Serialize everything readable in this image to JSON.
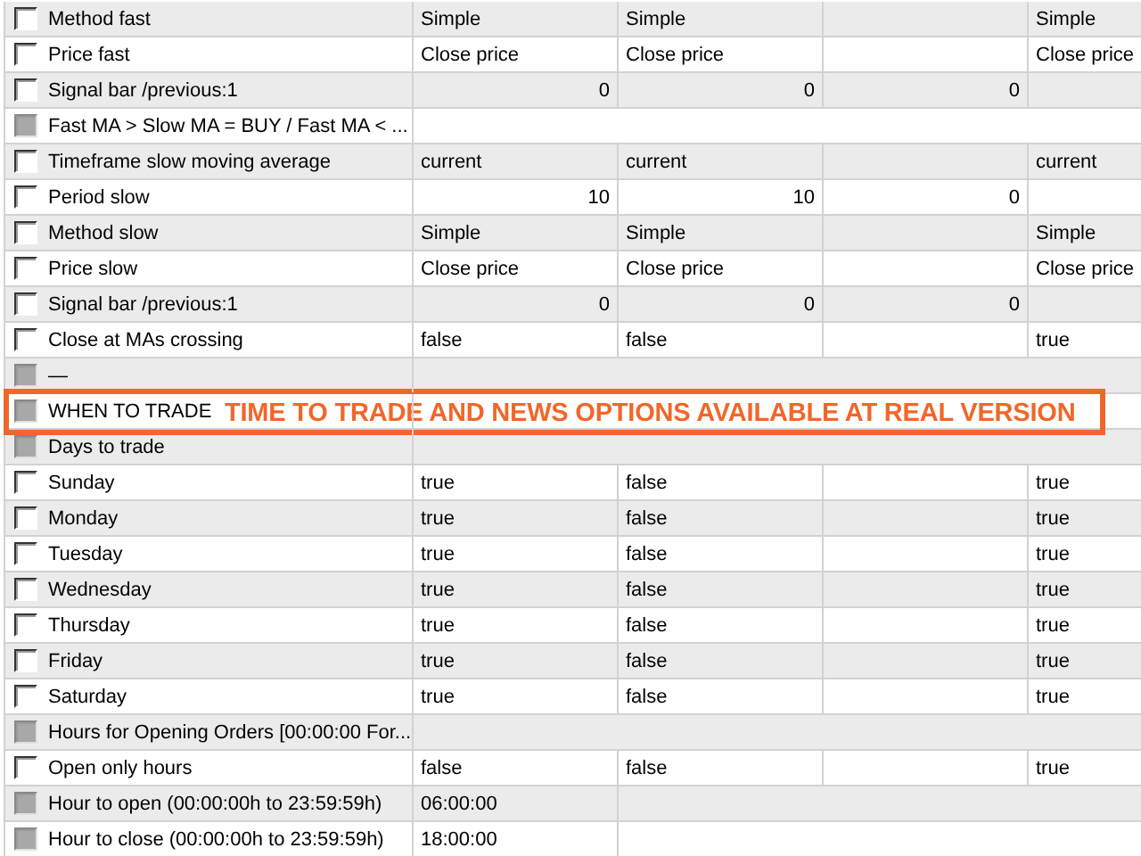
{
  "rows": [
    {
      "label": "Method fast",
      "kind": "text",
      "checked": false,
      "disabled": false,
      "column_2": "Simple",
      "column_3": "Simple",
      "column_5": "Simple"
    },
    {
      "label": "Price fast",
      "kind": "text",
      "checked": false,
      "disabled": false,
      "column_2": "Close price",
      "column_3": "Close price",
      "column_5": "Close price"
    },
    {
      "label": "Signal bar /previous:1",
      "kind": "number",
      "checked": false,
      "disabled": false,
      "column_2": "0",
      "column_3": "0",
      "column_4": "0"
    },
    {
      "label": "Fast MA > Slow MA = BUY / Fast MA < ...",
      "kind": "group",
      "checked": false,
      "disabled": true
    },
    {
      "label": "Timeframe slow moving average",
      "kind": "text",
      "checked": false,
      "disabled": false,
      "column_2": "current",
      "column_3": "current",
      "column_5": "current"
    },
    {
      "label": "Period slow",
      "kind": "number",
      "checked": false,
      "disabled": false,
      "column_2": "10",
      "column_3": "10",
      "column_4": "0"
    },
    {
      "label": "Method slow",
      "kind": "text",
      "checked": false,
      "disabled": false,
      "column_2": "Simple",
      "column_3": "Simple",
      "column_5": "Simple"
    },
    {
      "label": "Price slow",
      "kind": "text",
      "checked": false,
      "disabled": false,
      "column_2": "Close price",
      "column_3": "Close price",
      "column_5": "Close price"
    },
    {
      "label": "Signal bar /previous:1",
      "kind": "number",
      "checked": false,
      "disabled": false,
      "column_2": "0",
      "column_3": "0",
      "column_4": "0"
    },
    {
      "label": "Close at MAs crossing",
      "kind": "text",
      "checked": false,
      "disabled": false,
      "column_2": "false",
      "column_3": "false",
      "column_5": "true"
    },
    {
      "label": "—",
      "kind": "group",
      "checked": false,
      "disabled": true
    },
    {
      "label": "WHEN TO TRADE",
      "kind": "group",
      "checked": false,
      "disabled": true
    },
    {
      "label": "Days to trade",
      "kind": "group",
      "checked": false,
      "disabled": true
    },
    {
      "label": "Sunday",
      "kind": "text",
      "checked": false,
      "disabled": false,
      "column_2": "true",
      "column_3": "false",
      "column_5": "true"
    },
    {
      "label": "Monday",
      "kind": "text",
      "checked": false,
      "disabled": false,
      "column_2": "true",
      "column_3": "false",
      "column_5": "true"
    },
    {
      "label": "Tuesday",
      "kind": "text",
      "checked": false,
      "disabled": false,
      "column_2": "true",
      "column_3": "false",
      "column_5": "true"
    },
    {
      "label": "Wednesday",
      "kind": "text",
      "checked": false,
      "disabled": false,
      "column_2": "true",
      "column_3": "false",
      "column_5": "true"
    },
    {
      "label": "Thursday",
      "kind": "text",
      "checked": false,
      "disabled": false,
      "column_2": "true",
      "column_3": "false",
      "column_5": "true"
    },
    {
      "label": "Friday",
      "kind": "text",
      "checked": false,
      "disabled": false,
      "column_2": "true",
      "column_3": "false",
      "column_5": "true"
    },
    {
      "label": "Saturday",
      "kind": "text",
      "checked": false,
      "disabled": false,
      "column_2": "true",
      "column_3": "false",
      "column_5": "true"
    },
    {
      "label": "Hours for Opening Orders [00:00:00 For...",
      "kind": "group",
      "checked": false,
      "disabled": true
    },
    {
      "label": "Open only hours",
      "kind": "text",
      "checked": false,
      "disabled": false,
      "column_2": "false",
      "column_3": "false",
      "column_5": "true"
    },
    {
      "label": "Hour to open (00:00:00h to 23:59:59h)",
      "kind": "single",
      "checked": false,
      "disabled": true,
      "column_2": "06:00:00"
    },
    {
      "label": "Hour to close (00:00:00h to 23:59:59h)",
      "kind": "single",
      "checked": false,
      "disabled": true,
      "column_2": "18:00:00"
    }
  ],
  "banner": {
    "text": "TIME TO TRADE AND NEWS OPTIONS AVAILABLE AT REAL VERSION"
  }
}
